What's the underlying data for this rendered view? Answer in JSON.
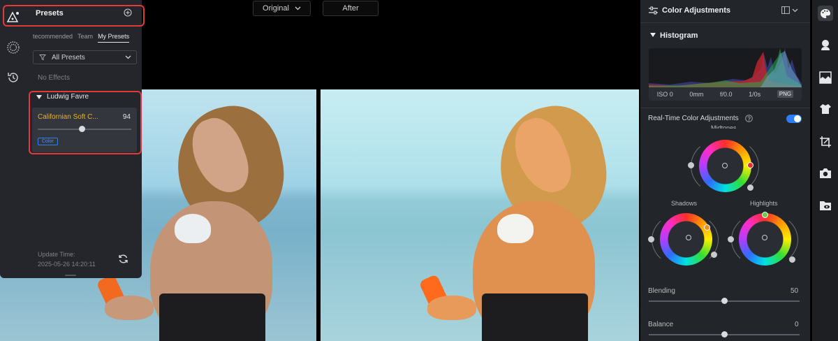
{
  "compare": {
    "original_label": "Original",
    "after_label": "After"
  },
  "presets_panel": {
    "title": "Presets",
    "tabs": [
      {
        "label": "tecommended"
      },
      {
        "label": "Team"
      },
      {
        "label": "My Presets"
      }
    ],
    "filter_label": "All Presets",
    "no_effects": "No Effects",
    "group_name": "Ludwig Favre",
    "preset": {
      "name": "Californian Soft C...",
      "value": "94",
      "level": 0.42,
      "tag": "Color"
    },
    "update_label": "Update Time:",
    "update_time": "2025-05-26 14:20:11"
  },
  "color_panel": {
    "title": "Color Adjustments",
    "histogram_title": "Histogram",
    "info": {
      "iso": "ISO 0",
      "focal": "0mm",
      "aperture": "f/0.0",
      "shutter": "1/0s",
      "format": "PNG"
    },
    "realtime_label": "Real-Time Color Adjustments",
    "realtime_enabled": true,
    "midtones_label": "Midtones",
    "shadows_label": "Shadows",
    "highlights_label": "Highlights",
    "blending_label": "Blending",
    "blending_value": "50",
    "balance_label": "Balance",
    "balance_value": "0"
  },
  "colors": {
    "accent": "#2f7df6",
    "highlight_box": "#e23a3a",
    "preset_name": "#e6b32a",
    "tag": "#2f7df6"
  }
}
